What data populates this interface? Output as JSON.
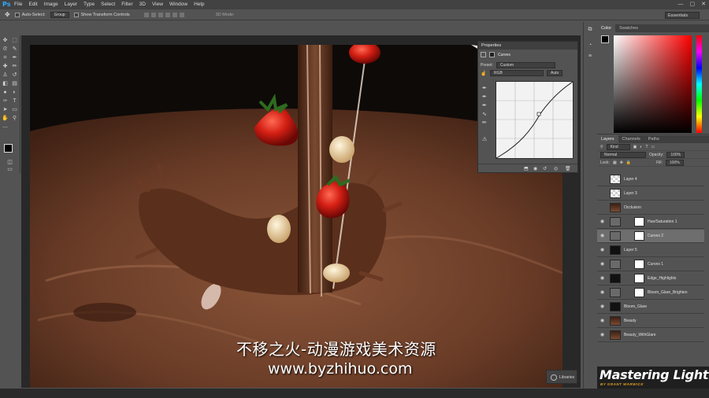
{
  "app": {
    "logo": "Ps",
    "brand_color": "#31a8ff"
  },
  "menu": [
    "File",
    "Edit",
    "Image",
    "Layer",
    "Type",
    "Select",
    "Filter",
    "3D",
    "View",
    "Window",
    "Help"
  ],
  "window_controls": [
    "—",
    "▢",
    "✕"
  ],
  "options_bar": {
    "auto_select_label": "Auto-Select:",
    "auto_select_value": "Group",
    "transform_label": "Show Transform Controls",
    "mode_3d_label": "3D Mode:",
    "workspace": "Essentials"
  },
  "properties": {
    "tab": "Properties",
    "adjustment": "Curves",
    "preset_label": "Preset:",
    "preset_value": "Custom",
    "channel_value": "RGB",
    "auto_label": "Auto"
  },
  "color_panel": {
    "tabs": [
      "Color",
      "Swatches"
    ]
  },
  "layers_panel": {
    "tabs": [
      "Layers",
      "Channels",
      "Paths"
    ],
    "filter_label": "Kind",
    "blend_mode": "Normal",
    "opacity_label": "Opacity:",
    "opacity_value": "100%",
    "lock_label": "Lock:",
    "fill_label": "Fill:",
    "fill_value": "100%",
    "layers": [
      {
        "name": "Layer 4",
        "visible": false,
        "thumb": "checker",
        "mask": false,
        "selected": false
      },
      {
        "name": "Layer 3",
        "visible": false,
        "thumb": "checker",
        "mask": false,
        "selected": false
      },
      {
        "name": "Occlusion",
        "visible": false,
        "thumb": "image",
        "mask": false,
        "selected": false
      },
      {
        "name": "Hue/Saturation 1",
        "visible": true,
        "thumb": "adjust",
        "mask": true,
        "selected": false
      },
      {
        "name": "Curves 2",
        "visible": true,
        "thumb": "adjust",
        "mask": true,
        "selected": true
      },
      {
        "name": "Layer 5",
        "visible": true,
        "thumb": "dark",
        "mask": false,
        "selected": false
      },
      {
        "name": "Curves 1",
        "visible": true,
        "thumb": "adjust",
        "mask": true,
        "selected": false
      },
      {
        "name": "Edge_Highlights",
        "visible": true,
        "thumb": "dark",
        "mask": true,
        "selected": false
      },
      {
        "name": "Bloom_Glare_Brighten",
        "visible": true,
        "thumb": "adjust",
        "mask": true,
        "selected": false
      },
      {
        "name": "Bloom_Glare",
        "visible": true,
        "thumb": "dark",
        "mask": false,
        "selected": false
      },
      {
        "name": "Beauty",
        "visible": true,
        "thumb": "image",
        "mask": false,
        "selected": false
      },
      {
        "name": "Beauty_WithGlare",
        "visible": true,
        "thumb": "image",
        "mask": false,
        "selected": false
      }
    ]
  },
  "libraries_label": "Libraries",
  "watermark": {
    "chinese": "不移之火-动漫游戏美术资源",
    "url": "www.byzhihuo.com"
  },
  "brand": {
    "title": "Mastering Lighting",
    "subtitle": "BY GRANT WARWICK"
  }
}
